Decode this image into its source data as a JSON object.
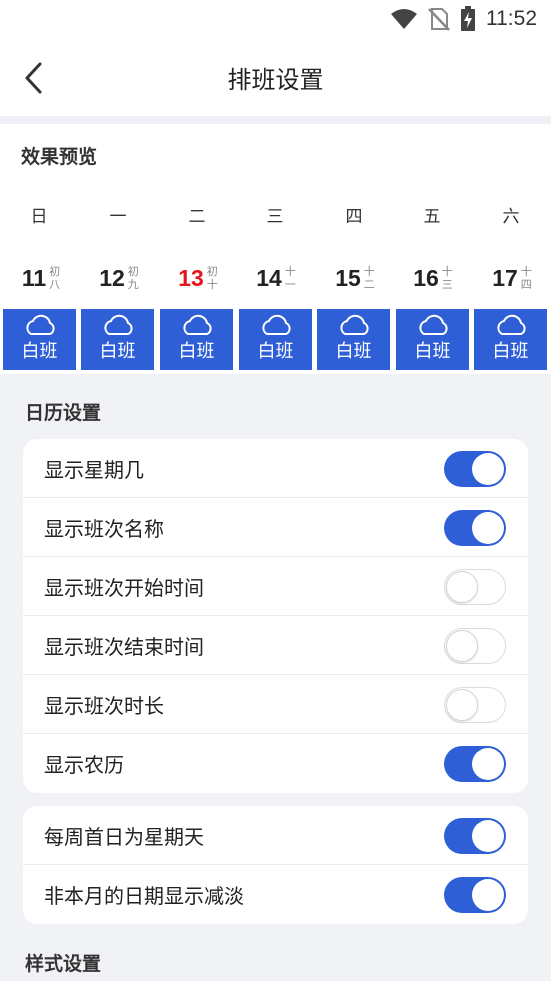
{
  "status_bar": {
    "time": "11:52",
    "icons": [
      "wifi-icon",
      "no-sim-icon",
      "battery-charging-icon"
    ]
  },
  "header": {
    "title": "排班设置",
    "back_icon": "chevron-left-icon"
  },
  "preview": {
    "label": "效果预览",
    "weekdays": [
      "日",
      "一",
      "二",
      "三",
      "四",
      "五",
      "六"
    ],
    "days": [
      {
        "day": "11",
        "lunar_top": "初",
        "lunar_bottom": "八",
        "today": false
      },
      {
        "day": "12",
        "lunar_top": "初",
        "lunar_bottom": "九",
        "today": false
      },
      {
        "day": "13",
        "lunar_top": "初",
        "lunar_bottom": "十",
        "today": true
      },
      {
        "day": "14",
        "lunar_top": "十",
        "lunar_bottom": "一",
        "today": false
      },
      {
        "day": "15",
        "lunar_top": "十",
        "lunar_bottom": "二",
        "today": false
      },
      {
        "day": "16",
        "lunar_top": "十",
        "lunar_bottom": "三",
        "today": false
      },
      {
        "day": "17",
        "lunar_top": "十",
        "lunar_bottom": "四",
        "today": false
      }
    ],
    "shifts": [
      "白班",
      "白班",
      "白班",
      "白班",
      "白班",
      "白班",
      "白班"
    ],
    "shift_icon": "cloud-icon",
    "shift_color": "#2f5fd6",
    "today_color": "#e8141c"
  },
  "calendar_settings": {
    "title": "日历设置",
    "items": [
      {
        "label": "显示星期几",
        "on": true
      },
      {
        "label": "显示班次名称",
        "on": true
      },
      {
        "label": "显示班次开始时间",
        "on": false
      },
      {
        "label": "显示班次结束时间",
        "on": false
      },
      {
        "label": "显示班次时长",
        "on": false
      },
      {
        "label": "显示农历",
        "on": true
      }
    ]
  },
  "week_settings": {
    "items": [
      {
        "label": "每周首日为星期天",
        "on": true
      },
      {
        "label": "非本月的日期显示减淡",
        "on": true
      }
    ]
  },
  "style_settings": {
    "title": "样式设置"
  },
  "accent_color": "#2f5fd6"
}
